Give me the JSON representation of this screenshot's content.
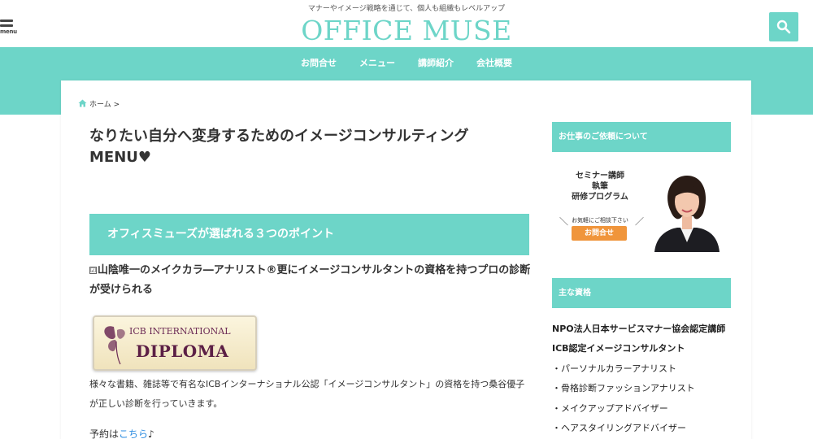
{
  "header": {
    "tagline": "マナーやイメージ戦略を通じて、個人も組織もレベルアップ",
    "logo": "OFFICE MUSE",
    "menu_label": "menu"
  },
  "nav": {
    "items": [
      {
        "label": "お問合せ"
      },
      {
        "label": "メニュー"
      },
      {
        "label": "講師紹介"
      },
      {
        "label": "会社概要"
      }
    ]
  },
  "breadcrumb": {
    "home": "ホーム",
    "sep": ">"
  },
  "main": {
    "title": "なりたい自分へ変身するためのイメージコンサルティングMENU♥",
    "points_heading": "オフィスミューズが選ばれる３つのポイント",
    "lead_check": "☑",
    "lead": "山陰唯一のメイクカラ―アナリスト®更にイメージコンサルタントの資格を持つプロの診断が受けられる",
    "diploma_line1": "ICB INTERNATIONAL",
    "diploma_line2": "DIPLOMA",
    "description": "様々な書籍、雑誌等で有名なICBインターナショナル公認「イメージコンサルタント」の資格を持つ桑谷優子が正しい診断を行っていきます。",
    "reserve_prefix": "予約は",
    "reserve_link": "こちら",
    "reserve_suffix": "♪"
  },
  "sidebar": {
    "work_heading": "お仕事のご依頼について",
    "promo_line1": "セミナー講師",
    "promo_line2": "執筆",
    "promo_line3": "研修プログラム",
    "promo_call": "お気軽にご相談下さい",
    "promo_button": "お問合せ",
    "qual_heading": "主な資格",
    "qualifications": [
      "NPO法人日本サービスマナー協会認定講師",
      "ICB認定イメージコンサルタント",
      "・パーソナルカラーアナリスト",
      "・骨格診断ファッションアナリスト",
      "・メイクアップアドバイザー",
      "・ヘアスタイリングアドバイザー"
    ]
  },
  "colors": {
    "accent": "#6dd5c8",
    "button_orange": "#f0953b",
    "link": "#2a8be0"
  }
}
